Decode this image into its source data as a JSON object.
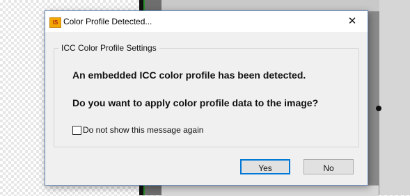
{
  "dialog": {
    "title": "Color Profile Detected...",
    "app_icon_text": "IS",
    "close_glyph": "✕",
    "group_title": "ICC Color Profile Settings",
    "message_line1": "An embedded ICC color profile has been detected.",
    "message_line2": "Do you want to apply color profile data to the image?",
    "checkbox_label": "Do not show this message again",
    "checkbox_checked": false,
    "yes_label": "Yes",
    "no_label": "No"
  },
  "icons": {
    "app": "app-logo-icon",
    "close": "close-icon"
  },
  "colors": {
    "dialog_bg": "#f0f0f0",
    "default_button_border": "#0078d7",
    "app_icon_bg": "#f2a800"
  }
}
